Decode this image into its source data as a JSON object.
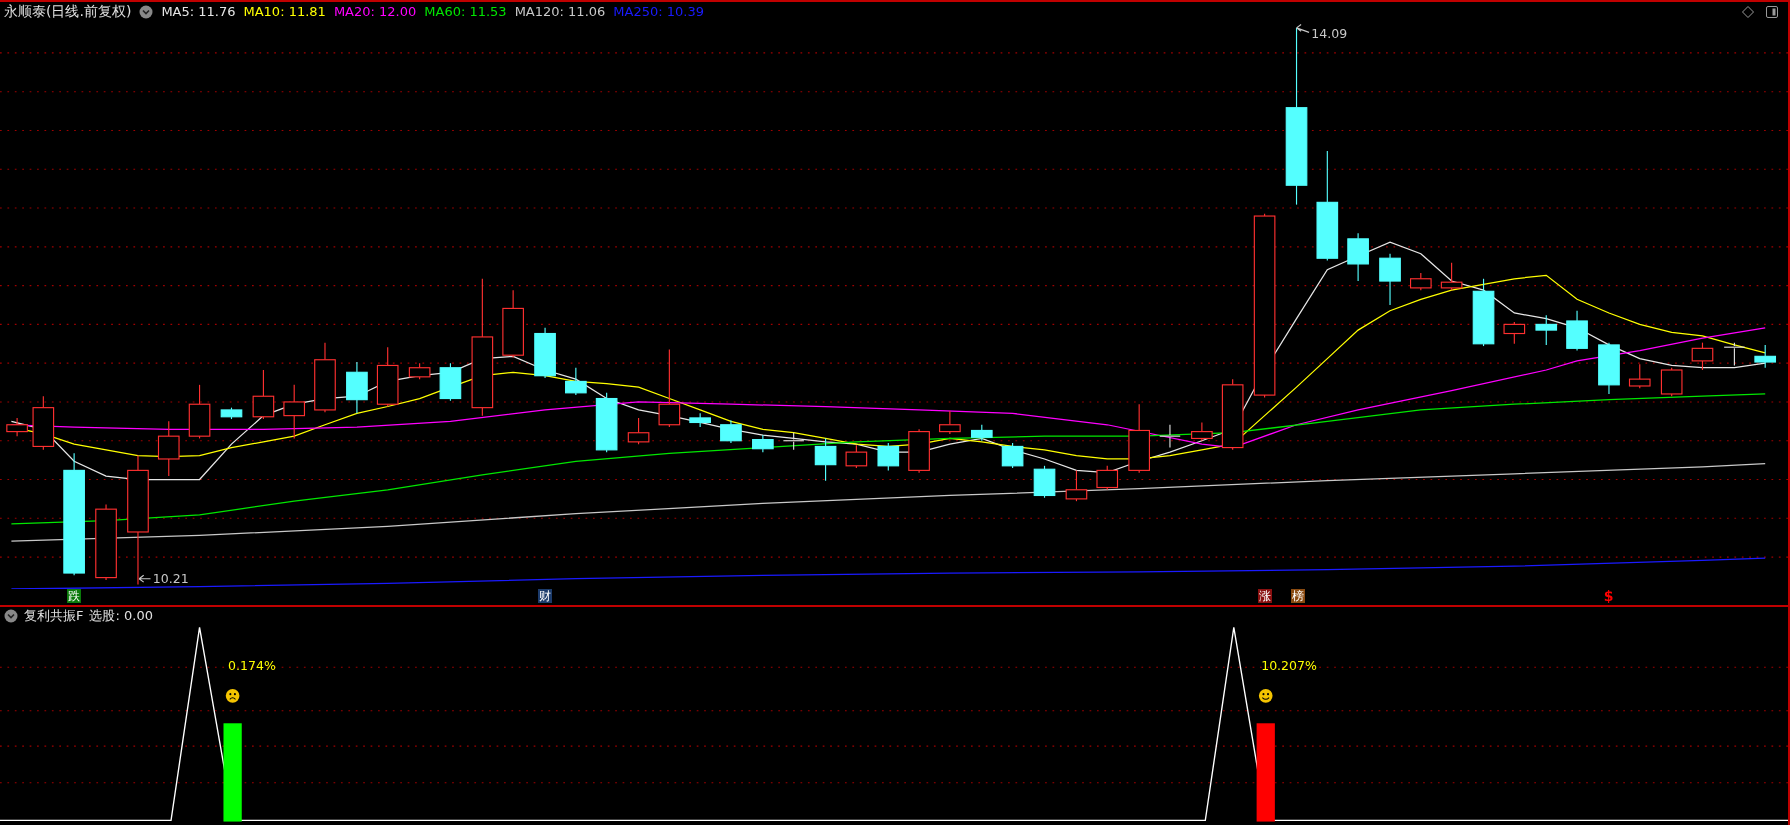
{
  "title": "永顺泰(日线.前复权)",
  "moving_averages": [
    {
      "label": "MA5: 11.76",
      "color": "#e6e6e6"
    },
    {
      "label": "MA10: 11.81",
      "color": "#ffff00"
    },
    {
      "label": "MA20: 12.00",
      "color": "#ff00ff"
    },
    {
      "label": "MA60: 11.53",
      "color": "#00e600"
    },
    {
      "label": "MA120: 11.06",
      "color": "#c8c8c8"
    },
    {
      "label": "MA250: 10.39",
      "color": "#1a1aff"
    }
  ],
  "price_labels": [
    {
      "kind": "high",
      "text": "14.09"
    },
    {
      "kind": "low",
      "text": "10.21"
    }
  ],
  "event_markers": [
    {
      "kind": "badge",
      "label": "跌",
      "color": "#0a7a0a"
    },
    {
      "kind": "badge",
      "label": "财",
      "color": "#1c3b6b"
    },
    {
      "kind": "badge",
      "label": "涨",
      "color": "#8a1010"
    },
    {
      "kind": "badge",
      "label": "榜",
      "color": "#8a4a10"
    },
    {
      "kind": "text",
      "label": "$",
      "color": "#ff0000"
    }
  ],
  "indicator": {
    "title": "复利共振F",
    "reading": "选股: 0.00",
    "signals": [
      {
        "kind": "fall",
        "value": "0.174%"
      },
      {
        "kind": "rise",
        "value": "10.207%"
      }
    ]
  }
}
